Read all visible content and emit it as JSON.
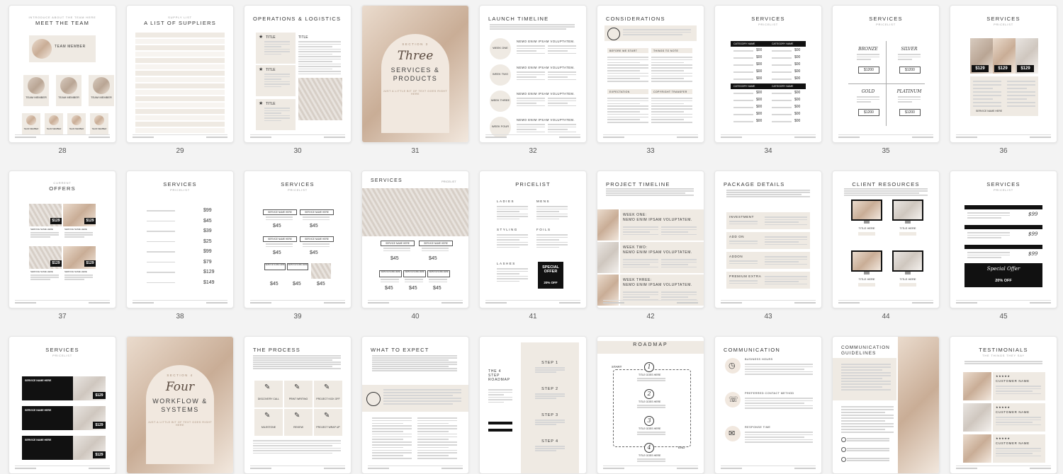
{
  "app": {
    "title": "Template pages overview"
  },
  "pages": [
    {
      "number": "28",
      "kind": "team",
      "title": "MEET THE TEAM",
      "subtitle": "INTRODUCE ABOUT THE TEAM HERE",
      "lead_label": "TEAM MEMBER",
      "member_label": "TEAM MEMBER",
      "small_label": "TEAM MEMBER"
    },
    {
      "number": "29",
      "kind": "suppliers",
      "title": "A LIST OF SUPPLIERS",
      "subtitle": "SUPPLY LIST"
    },
    {
      "number": "30",
      "kind": "operations",
      "title": "OPERATIONS & LOGISTICS",
      "item_label": "TITLE"
    },
    {
      "number": "31",
      "kind": "section",
      "section": "SECTION 3",
      "script": "Three",
      "heading": "SERVICES & PRODUCTS",
      "tagline": "JUST A LITTLE BIT OF TEXT GOES RIGHT HERE"
    },
    {
      "number": "32",
      "kind": "timeline",
      "title": "LAUNCH TIMELINE",
      "weeks": [
        "WEEK ONE",
        "WEEK TWO",
        "WEEK THREE",
        "WEEK FOUR"
      ],
      "row_title": "NEMO ENIM IPSAM VOLUPTATEM."
    },
    {
      "number": "33",
      "kind": "considerations",
      "title": "CONSIDERATIONS",
      "headings": [
        "BEFORE WE START",
        "THINGS TO NOTE",
        "EXPECTATION",
        "COPYRIGHT TRANSFER"
      ]
    },
    {
      "number": "34",
      "kind": "pricelist-table",
      "title": "SERVICES",
      "subtitle": "PRICELIST",
      "col_a": "CATEGORY NAME",
      "col_b": "CATEGORY NAME",
      "prices": [
        "$00",
        "$00",
        "$00",
        "$00",
        "$00"
      ]
    },
    {
      "number": "35",
      "kind": "tiers",
      "title": "SERVICES",
      "subtitle": "PRICELIST",
      "tiers": [
        {
          "name": "BRONZE",
          "price": "$1200"
        },
        {
          "name": "SILVER",
          "price": "$1200"
        },
        {
          "name": "GOLD",
          "price": "$1200"
        },
        {
          "name": "PLATINUM",
          "price": "$1200"
        }
      ]
    },
    {
      "number": "36",
      "kind": "photo-prices",
      "title": "SERVICES",
      "subtitle": "PRICELIST",
      "prices": [
        "$129",
        "$129",
        "$129"
      ],
      "cta": "SERVICE NAME HERE"
    },
    {
      "number": "37",
      "kind": "offers",
      "title": "OFFERS",
      "subtitle": "CURRENT",
      "prices": [
        "$129",
        "$129",
        "$129",
        "$129"
      ],
      "label": "SERVICE NAME HERE"
    },
    {
      "number": "38",
      "kind": "pricelist-simple",
      "title": "SERVICES",
      "subtitle": "PRICELIST",
      "prices": [
        "$99",
        "$45",
        "$39",
        "$25",
        "$99",
        "$79",
        "$129",
        "$149"
      ]
    },
    {
      "number": "39",
      "kind": "pricelist-boxes",
      "title": "SERVICES",
      "subtitle": "PRICELIST",
      "label": "SERVICE NAME HERE",
      "price": "$45"
    },
    {
      "number": "40",
      "kind": "pricelist-photo",
      "title": "SERVICES",
      "tag": "PRICELIST",
      "label": "SERVICE NAME HERE",
      "price": "$45"
    },
    {
      "number": "41",
      "kind": "pricelist-salon",
      "title": "PRICELIST",
      "cols": [
        "LADIES",
        "MENS",
        "STYLING",
        "FOILS",
        "LASHES"
      ],
      "offer_title": "SPECIAL OFFER",
      "offer_text": "20% OFF"
    },
    {
      "number": "42",
      "kind": "project-timeline",
      "title": "PROJECT TIMELINE",
      "rows": [
        "WEEK ONE:",
        "WEEK TWO:",
        "WEEK THREE:"
      ],
      "row_title": "NEMO ENIM IPSAM VOLUPTATEM."
    },
    {
      "number": "43",
      "kind": "packages",
      "title": "PACKAGE DETAILS",
      "rows": [
        "INVESTMENT",
        "ADD ON",
        "ADDON",
        "PREMIUM EXTRA"
      ]
    },
    {
      "number": "44",
      "kind": "resources",
      "title": "CLIENT RESOURCES",
      "label": "TITLE HERE"
    },
    {
      "number": "45",
      "kind": "pricelist-bars",
      "title": "SERVICES",
      "subtitle": "PRICELIST",
      "price": "$99",
      "offer_title": "Special Offer",
      "offer_text": "20% OFF"
    },
    {
      "number": "",
      "kind": "services-dark",
      "title": "SERVICES",
      "subtitle": "PRICELIST",
      "label": "SERVICE NAME HERE",
      "price": "$129"
    },
    {
      "number": "",
      "kind": "section",
      "section": "SECTION 4",
      "script": "Four",
      "heading": "WORKFLOW & SYSTEMS",
      "tagline": "JUST A LITTLE BIT OF TEXT GOES RIGHT HERE"
    },
    {
      "number": "",
      "kind": "process",
      "title": "THE PROCESS",
      "steps": [
        "DISCOVERY CALL",
        "PRINT WRITING",
        "PROJECT KICK OFF",
        "MILESTONE",
        "REVIEW",
        "PROJECT WRAP UP"
      ]
    },
    {
      "number": "",
      "kind": "expect",
      "title": "WHAT TO EXPECT"
    },
    {
      "number": "",
      "kind": "roadmap-steps",
      "title": "THE 4 STEP ROADMAP",
      "steps": [
        "STEP 1",
        "STEP 2",
        "STEP 3",
        "STEP 4"
      ]
    },
    {
      "number": "",
      "kind": "roadmap",
      "title": "ROADMAP",
      "start": "START",
      "end": "END",
      "label": "TITLE GOES HERE",
      "nums": [
        "1",
        "2",
        "3",
        "4"
      ]
    },
    {
      "number": "",
      "kind": "communication",
      "title": "COMMUNICATION",
      "headings": [
        "BUSINESS HOURS",
        "PREFERRED CONTACT METHOD",
        "RESPONSE TIME"
      ]
    },
    {
      "number": "",
      "kind": "guidelines",
      "title": "COMMUNICATION GUIDELINES"
    },
    {
      "number": "",
      "kind": "testimonials",
      "title": "TESTIMONIALS",
      "subtitle": "THE THINGS THEY SAY",
      "name": "CUSTOMER NAME"
    }
  ]
}
